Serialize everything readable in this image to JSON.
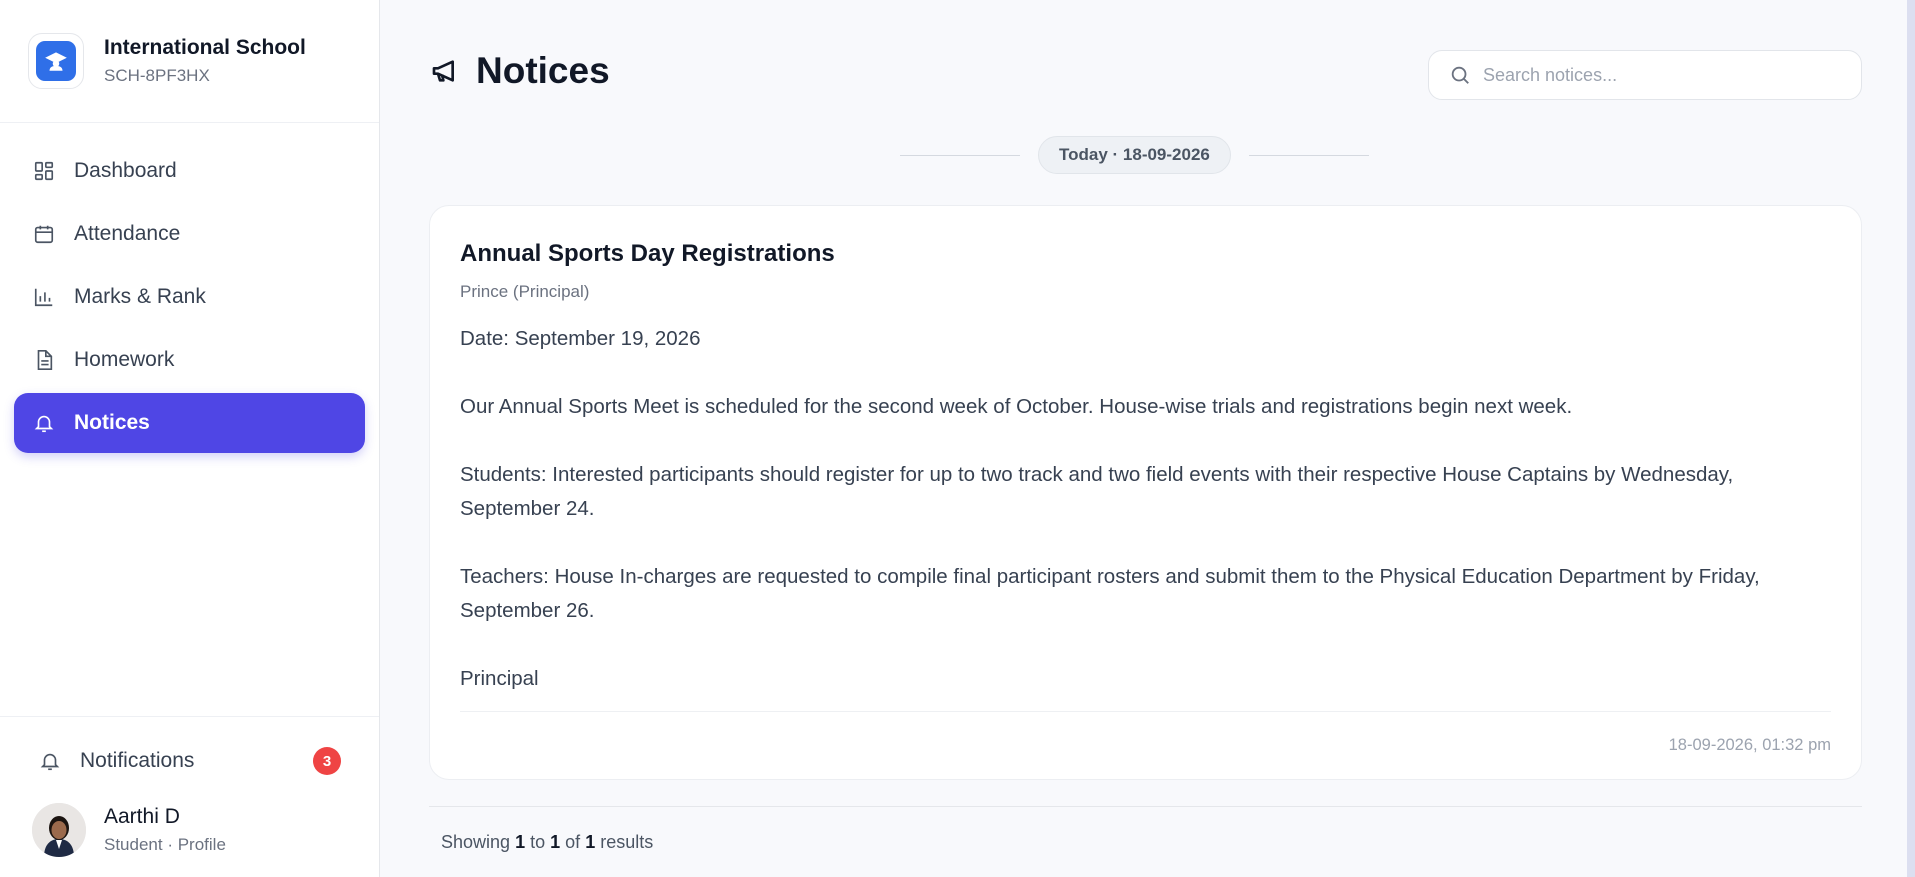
{
  "school": {
    "name": "International School",
    "code": "SCH-8PF3HX"
  },
  "sidebar": {
    "items": [
      {
        "label": "Dashboard",
        "icon": "grid-icon"
      },
      {
        "label": "Attendance",
        "icon": "calendar-icon"
      },
      {
        "label": "Marks & Rank",
        "icon": "bar-chart-icon"
      },
      {
        "label": "Homework",
        "icon": "document-icon"
      },
      {
        "label": "Notices",
        "icon": "bell-icon",
        "active": true
      }
    ],
    "notifications_label": "Notifications",
    "notifications_count": "3"
  },
  "user": {
    "name": "Aarthi D",
    "subtitle": "Student · Profile"
  },
  "page": {
    "title": "Notices",
    "search_placeholder": "Search notices..."
  },
  "date_group": "Today · 18-09-2026",
  "notice": {
    "title": "Annual Sports Day Registrations",
    "author": "Prince (Principal)",
    "paragraphs": [
      "Date: September 19, 2026",
      "Our Annual Sports Meet is scheduled for the second week of October. House-wise trials and registrations begin next week.",
      "Students: Interested participants should register for up to two track and two field events with their respective House Captains by Wednesday, September 24.",
      "Teachers: House In-charges are requested to compile final participant rosters and submit them to the Physical Education Department by Friday, September 26.",
      "Principal"
    ],
    "timestamp": "18-09-2026, 01:32 pm"
  },
  "pagination": {
    "prefix": "Showing",
    "from": "1",
    "to_word": "to",
    "to": "1",
    "of_word": "of",
    "total": "1",
    "suffix": "results"
  },
  "colors": {
    "accent": "#4f46e5",
    "badge": "#ef4444",
    "logo": "#2f6fe8"
  }
}
